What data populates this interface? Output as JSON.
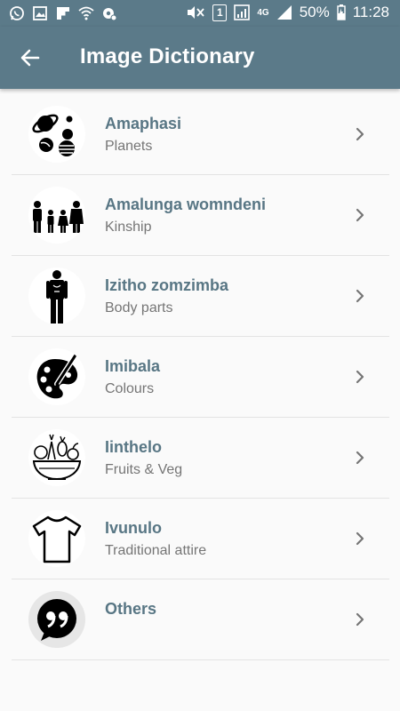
{
  "status_bar": {
    "battery": "50%",
    "time": "11:28",
    "sim_slot": "1",
    "network": "4G",
    "left_icons": [
      "whatsapp-icon",
      "gallery-icon",
      "flipboard-icon",
      "wifi-call-icon",
      "settings-notify-icon"
    ],
    "right_icons": [
      "mute-icon",
      "sim-icon",
      "signal-icon",
      "network-4g-icon",
      "battery-icon"
    ]
  },
  "app_bar": {
    "title": "Image Dictionary",
    "back_icon": "arrow-back-icon"
  },
  "colors": {
    "app_bar": "#5b7a89",
    "item_title": "#587684",
    "item_subtitle": "#757575",
    "background": "#fafafa"
  },
  "categories": [
    {
      "title": "Amaphasi",
      "subtitle": "Planets",
      "icon": "planets-icon"
    },
    {
      "title": "Amalunga womndeni",
      "subtitle": "Kinship",
      "icon": "family-icon"
    },
    {
      "title": "Izitho zomzimba",
      "subtitle": "Body parts",
      "icon": "body-icon"
    },
    {
      "title": "Imibala",
      "subtitle": "Colours",
      "icon": "palette-icon"
    },
    {
      "title": "Iinthelo",
      "subtitle": "Fruits & Veg",
      "icon": "salad-bowl-icon"
    },
    {
      "title": "Ivunulo",
      "subtitle": "Traditional attire",
      "icon": "tshirt-icon"
    },
    {
      "title": "Others",
      "subtitle": "",
      "icon": "quote-bubble-icon"
    }
  ]
}
